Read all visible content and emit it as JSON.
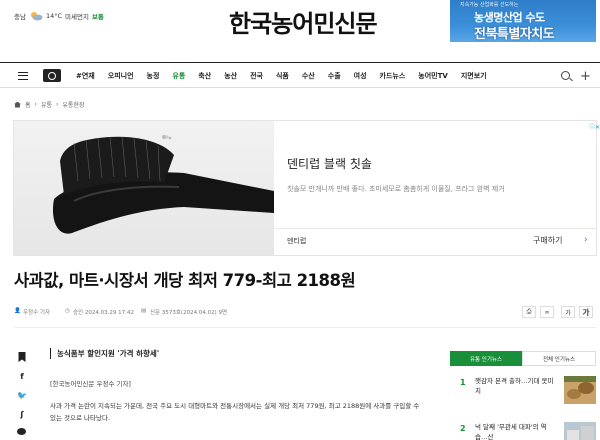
{
  "weather": {
    "region": "충남",
    "temp": "14°C",
    "dust_label": "미세먼지",
    "dust_status": "보통"
  },
  "site": {
    "logo": "한국농어민신문"
  },
  "top_ad": {
    "small": "지속가능 산업화를 선도하는",
    "line1": "농생명산업 수도",
    "line2": "전북특별자치도"
  },
  "nav": {
    "items": [
      "#연재",
      "오피니언",
      "농정",
      "유통",
      "축산",
      "농산",
      "전국",
      "식품",
      "수산",
      "수출",
      "여성",
      "카드뉴스",
      "농어민TV",
      "지면보기"
    ],
    "active_index": 3
  },
  "breadcrumb": {
    "home": "홈",
    "level1": "유통",
    "level2": "유통현장"
  },
  "ad": {
    "title": "덴티럽 블랙 칫솔",
    "desc": "칫솔모 만개니까 만배 좋다. 초미세모로 촘촘하게 이물질, 프라그 완벽 제거",
    "advertiser": "덴티럽",
    "cta": "구매하기",
    "cta_chevron": "›"
  },
  "article": {
    "headline": "사과값, 마트·시장서 개당 최저 779-최고 2188원",
    "author": "우정수 기자",
    "approved": "승인 2024.03.29 17:42",
    "edition": "신문 3573호(2024.04.02) 9면",
    "font_small": "가",
    "font_large": "가",
    "subhead": "농식품부 할인지원 '가격 하향세'",
    "byline": "[한국농어민신문 우정수 기자]",
    "body": "사과 가격 논란이 지속되는 가운데, 전국 주요 도시 대형마트와 전통시장에서는 실제 개당 최저 779원, 최고 2188원에 사과를 구입할 수 있는 것으로 나타났다."
  },
  "popular": {
    "tab_active": "유통 인기뉴스",
    "tab_other": "전체 인기뉴스",
    "items": [
      {
        "rank": "1",
        "text": "햇감자 본격 출하…기대 못미치"
      },
      {
        "rank": "2",
        "text": "넉 달째 '무관세 대파'의 역습…산"
      }
    ]
  }
}
